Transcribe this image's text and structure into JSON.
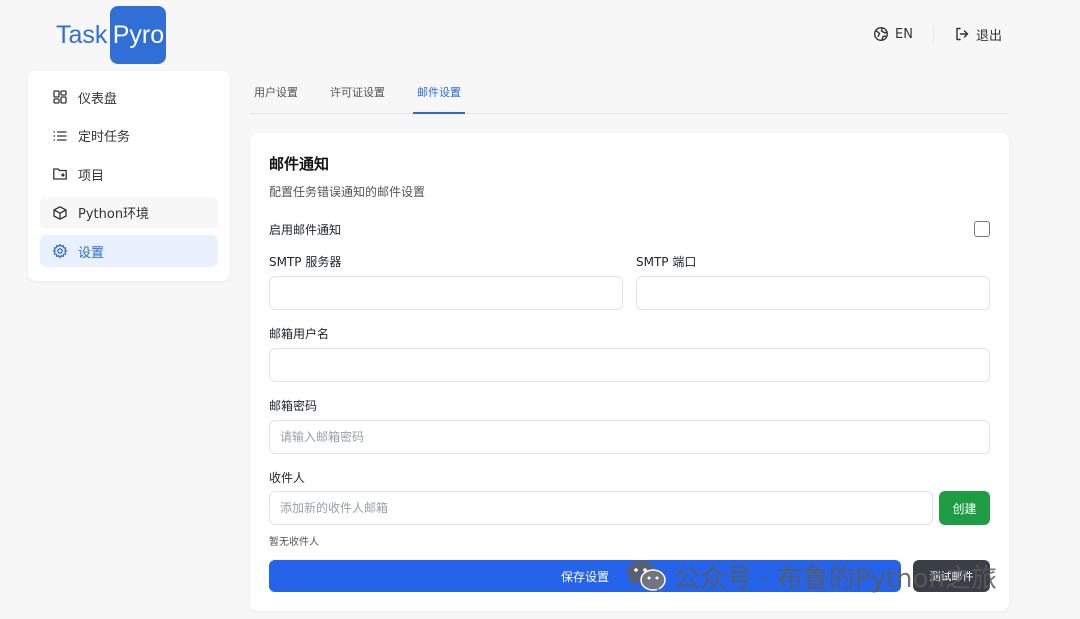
{
  "header": {
    "logo_part1": "Task",
    "logo_part2": "Pyro",
    "lang_label": "EN",
    "logout_label": "退出"
  },
  "sidebar": {
    "items": [
      {
        "label": "仪表盘",
        "icon": "dashboard-icon"
      },
      {
        "label": "定时任务",
        "icon": "list-icon"
      },
      {
        "label": "项目",
        "icon": "folder-icon"
      },
      {
        "label": "Python环境",
        "icon": "cube-icon"
      },
      {
        "label": "设置",
        "icon": "gear-icon",
        "active": true
      }
    ]
  },
  "tabs": [
    {
      "label": "用户设置"
    },
    {
      "label": "许可证设置"
    },
    {
      "label": "邮件设置",
      "active": true
    }
  ],
  "form": {
    "title": "邮件通知",
    "description": "配置任务错误通知的邮件设置",
    "enable_label": "启用邮件通知",
    "enable_checked": false,
    "smtp_server_label": "SMTP 服务器",
    "smtp_server_value": "",
    "smtp_port_label": "SMTP 端口",
    "smtp_port_value": "",
    "username_label": "邮箱用户名",
    "username_value": "",
    "password_label": "邮箱密码",
    "password_placeholder": "请输入邮箱密码",
    "recipients_label": "收件人",
    "recipient_placeholder": "添加新的收件人邮箱",
    "create_label": "创建",
    "no_recipients": "暂无收件人",
    "save_label": "保存设置",
    "test_label": "测试邮件"
  },
  "watermark": {
    "text": "公众号 · 布鲁的Python之旅"
  },
  "colors": {
    "primary": "#2563eb",
    "accent_blue": "#2b6bd6",
    "success": "#1f9d45",
    "dark_button": "#3a3f47",
    "logo_blue": "#2f6fd6"
  }
}
